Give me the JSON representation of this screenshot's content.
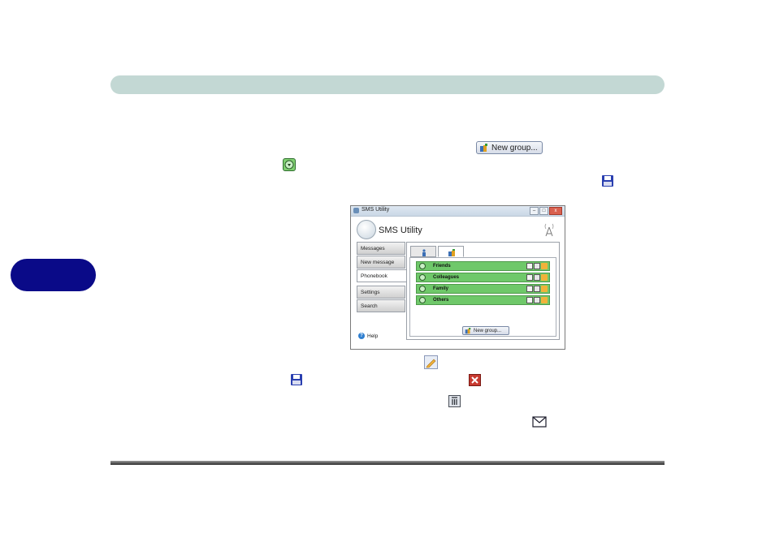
{
  "colors": {
    "header_bar": "#c3d8d4",
    "chapter_tab": "#0a0a88",
    "group_row": "#6fc86a"
  },
  "inline_buttons": {
    "new_group_label": "New group..."
  },
  "icons": [
    "new-group-icon",
    "expand-icon",
    "save-icon",
    "edit-icon",
    "cancel-icon",
    "trash-icon",
    "mail-icon"
  ],
  "window": {
    "titlebar_title": "SMS Utility",
    "controls": [
      "–",
      "□",
      "x"
    ],
    "app_title": "SMS Utility",
    "nav": [
      {
        "label": "Messages"
      },
      {
        "label": "New message"
      },
      {
        "label": "Phonebook"
      },
      {
        "label": "Settings"
      },
      {
        "label": "Search"
      }
    ],
    "active_nav": "Phonebook",
    "help_label": "Help",
    "groups": [
      {
        "name": "Friends"
      },
      {
        "name": "Colleagues"
      },
      {
        "name": "Family"
      },
      {
        "name": "Others"
      }
    ],
    "new_group_button": "New group..."
  }
}
